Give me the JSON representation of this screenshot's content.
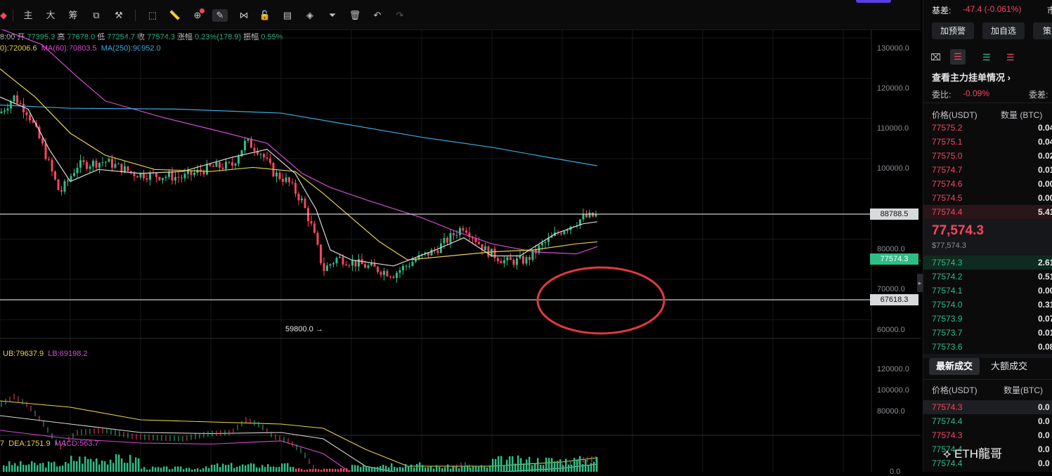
{
  "toolbar": {
    "tabs": [
      "主",
      "大",
      "筹"
    ],
    "icons": [
      "indicator-icon",
      "tools-icon",
      "cursor-icon",
      "ruler-icon",
      "zoom-icon",
      "pen-icon",
      "pattern-icon",
      "lock-icon",
      "template-icon",
      "magnet-icon",
      "filter-icon",
      "delete-icon",
      "undo-icon",
      "redo-icon"
    ]
  },
  "ohlc": {
    "time": "8:00",
    "open_label": "开",
    "open": "77395.3",
    "high_label": "高",
    "high": "77678.0",
    "low_label": "低",
    "low": "77254.7",
    "close_label": "收",
    "close": "77574.3",
    "change_label": "涨幅",
    "change": "0.23%(178.9)",
    "amp_label": "振幅",
    "amp": "0.55%"
  },
  "ma": {
    "ma_a": "0):72006.6",
    "ma60": "MA(60):70803.5",
    "ma250": "MA(250):90952.0",
    "colors": {
      "ma_a": "#e8d24a",
      "ma60": "#d44bd1",
      "ma250": "#3aa9e0"
    }
  },
  "price_axis": [
    "130000.0",
    "120000.0",
    "110000.0",
    "100000.0",
    "80000.0",
    "70000.0",
    "60000.0"
  ],
  "price_tags": {
    "line1": "88788.5",
    "current": "77574.3",
    "line2": "67618.3"
  },
  "low_annotation": "59800.0 →",
  "boll": {
    "ub": "UB:79637.9",
    "lb": "LB:69198.2",
    "axis": [
      "120000.0",
      "100000.0",
      "80000.0"
    ]
  },
  "macd": {
    "prefix": "7",
    "dea": "DEA:1751.9",
    "macd": "MACD:563.7",
    "axis_bottom": "0.0"
  },
  "panel": {
    "basis_label": "基差:",
    "basis_value": "-47.4 (-0.061%)",
    "edge_char": "市",
    "buttons": [
      "加预警",
      "加自选",
      "策"
    ],
    "main_orders_link": "查看主力挂单情况",
    "ratio_label": "委比:",
    "ratio_value": "-0.09%",
    "diff_label": "委差:",
    "book_header": {
      "price": "价格(USDT)",
      "qty": "数量 (BTC)"
    },
    "asks": [
      {
        "price": "77575.2",
        "qty": "0.04"
      },
      {
        "price": "77575.1",
        "qty": "0.04"
      },
      {
        "price": "77575.0",
        "qty": "0.02"
      },
      {
        "price": "77574.7",
        "qty": "0.01"
      },
      {
        "price": "77574.6",
        "qty": "0.00"
      },
      {
        "price": "77574.5",
        "qty": "0.00"
      },
      {
        "price": "77574.4",
        "qty": "5.41"
      }
    ],
    "last_price": "77,574.3",
    "last_usd": "$77,574.3",
    "bids": [
      {
        "price": "77574.3",
        "qty": "2.61"
      },
      {
        "price": "77574.2",
        "qty": "0.51"
      },
      {
        "price": "77574.1",
        "qty": "0.00"
      },
      {
        "price": "77574.0",
        "qty": "0.31"
      },
      {
        "price": "77573.9",
        "qty": "0.07"
      },
      {
        "price": "77573.7",
        "qty": "0.01"
      },
      {
        "price": "77573.6",
        "qty": "0.08"
      }
    ],
    "trade_tabs": [
      "最新成交",
      "大额成交"
    ],
    "trade_header": {
      "price": "价格(USDT)",
      "qty": "数量(BTC)"
    },
    "trades": [
      {
        "price": "77574.3",
        "qty": "0.0",
        "side": "dn"
      },
      {
        "price": "77574.4",
        "qty": "0.0",
        "side": "up"
      },
      {
        "price": "77574.3",
        "qty": "0.0",
        "side": "dn"
      },
      {
        "price": "77574.4",
        "qty": "0.0",
        "side": "up"
      },
      {
        "price": "77574.4",
        "qty": "0.0",
        "side": "up"
      }
    ]
  },
  "watermark": "ETH龍哥",
  "colors": {
    "up": "#2ebd85",
    "down": "#f6465d",
    "circle": "#e0393f",
    "hline": "#ffffff"
  }
}
